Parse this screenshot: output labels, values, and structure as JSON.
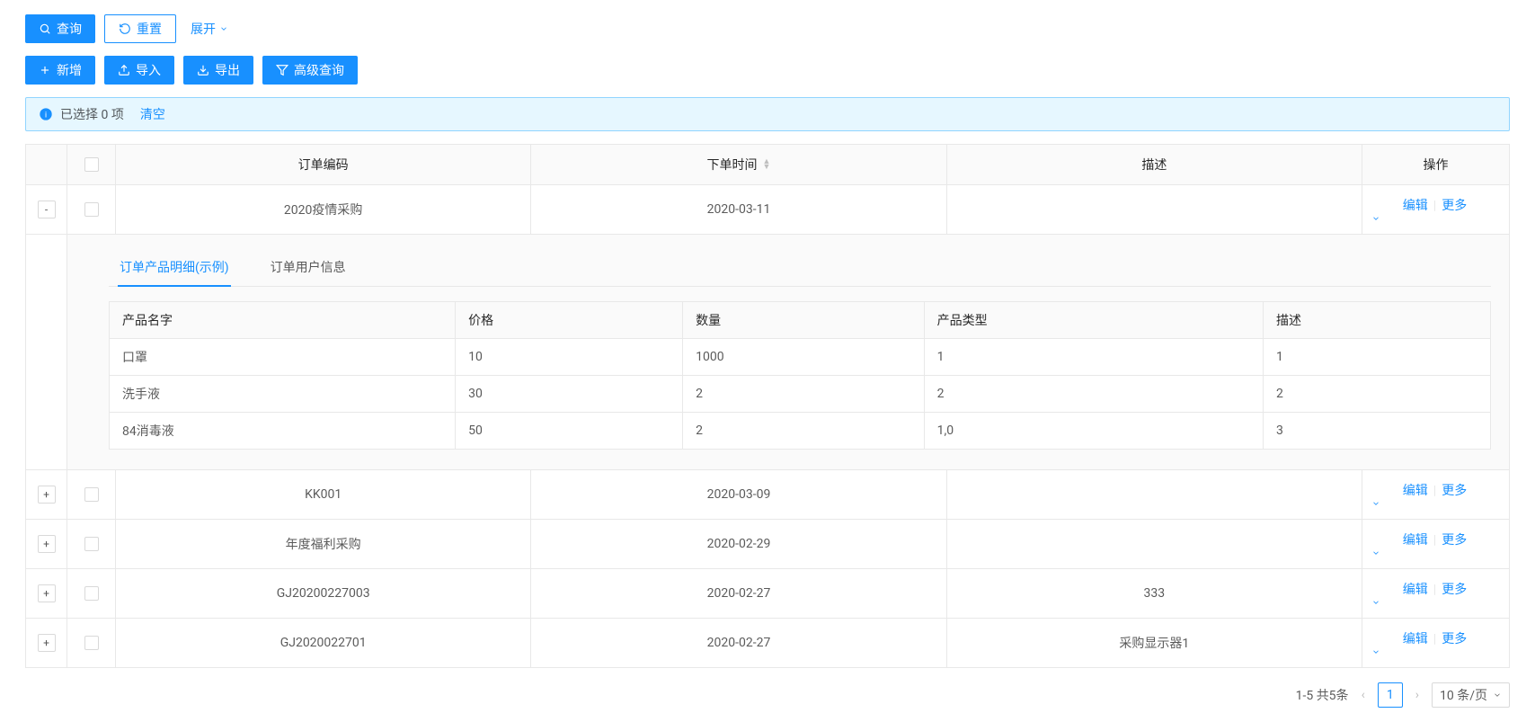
{
  "toolbar": {
    "search_label": "查询",
    "reset_label": "重置",
    "expand_label": "展开",
    "add_label": "新增",
    "import_label": "导入",
    "export_label": "导出",
    "adv_query_label": "高级查询"
  },
  "alert": {
    "selected_prefix": "已选择",
    "selected_count": "0",
    "selected_suffix": "项",
    "clear_label": "清空"
  },
  "columns": {
    "order_code": "订单编码",
    "order_time": "下单时间",
    "description": "描述",
    "actions": "操作"
  },
  "action_labels": {
    "edit": "编辑",
    "more": "更多"
  },
  "rows": [
    {
      "code": "2020疫情采购",
      "time": "2020-03-11",
      "desc": "",
      "expanded": true
    },
    {
      "code": "KK001",
      "time": "2020-03-09",
      "desc": "",
      "expanded": false
    },
    {
      "code": "年度福利采购",
      "time": "2020-02-29",
      "desc": "",
      "expanded": false
    },
    {
      "code": "GJ20200227003",
      "time": "2020-02-27",
      "desc": "333",
      "expanded": false
    },
    {
      "code": "GJ2020022701",
      "time": "2020-02-27",
      "desc": "采购显示器1",
      "expanded": false
    }
  ],
  "detail": {
    "tabs": [
      {
        "label": "订单产品明细(示例)",
        "active": true
      },
      {
        "label": "订单用户信息",
        "active": false
      }
    ],
    "columns": {
      "name": "产品名字",
      "price": "价格",
      "qty": "数量",
      "type": "产品类型",
      "desc": "描述"
    },
    "rows": [
      {
        "name": "口罩",
        "price": "10",
        "qty": "1000",
        "type": "1",
        "desc": "1"
      },
      {
        "name": "洗手液",
        "price": "30",
        "qty": "2",
        "type": "2",
        "desc": "2"
      },
      {
        "name": "84消毒液",
        "price": "50",
        "qty": "2",
        "type": "1,0",
        "desc": "3"
      }
    ]
  },
  "pagination": {
    "range_text": "1-5 共5条",
    "current_page": "1",
    "page_size_label": "10 条/页"
  }
}
